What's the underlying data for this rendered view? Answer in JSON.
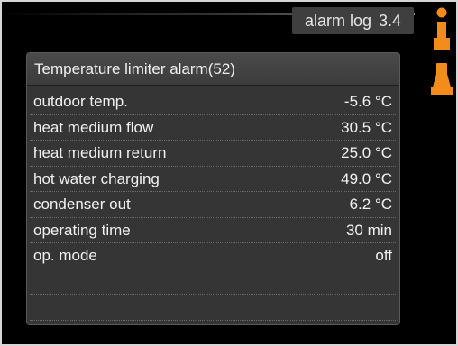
{
  "header": {
    "menu_name": "alarm log",
    "menu_number": "3.4"
  },
  "icons": {
    "info": "info-icon",
    "lock": "padlock-icon",
    "accent_color": "#f28c1a"
  },
  "alarm": {
    "title": "Temperature limiter alarm(52)",
    "rows": [
      {
        "label": "outdoor temp.",
        "value": "-5.6  °C"
      },
      {
        "label": "heat medium flow",
        "value": "30.5  °C"
      },
      {
        "label": "heat medium return",
        "value": "25.0  °C"
      },
      {
        "label": "hot water charging",
        "value": "49.0  °C"
      },
      {
        "label": "condenser out",
        "value": "6.2 °C"
      },
      {
        "label": "operating time",
        "value": "30 min"
      },
      {
        "label": "op. mode",
        "value": "off"
      },
      {
        "label": "",
        "value": ""
      },
      {
        "label": "",
        "value": ""
      }
    ]
  }
}
